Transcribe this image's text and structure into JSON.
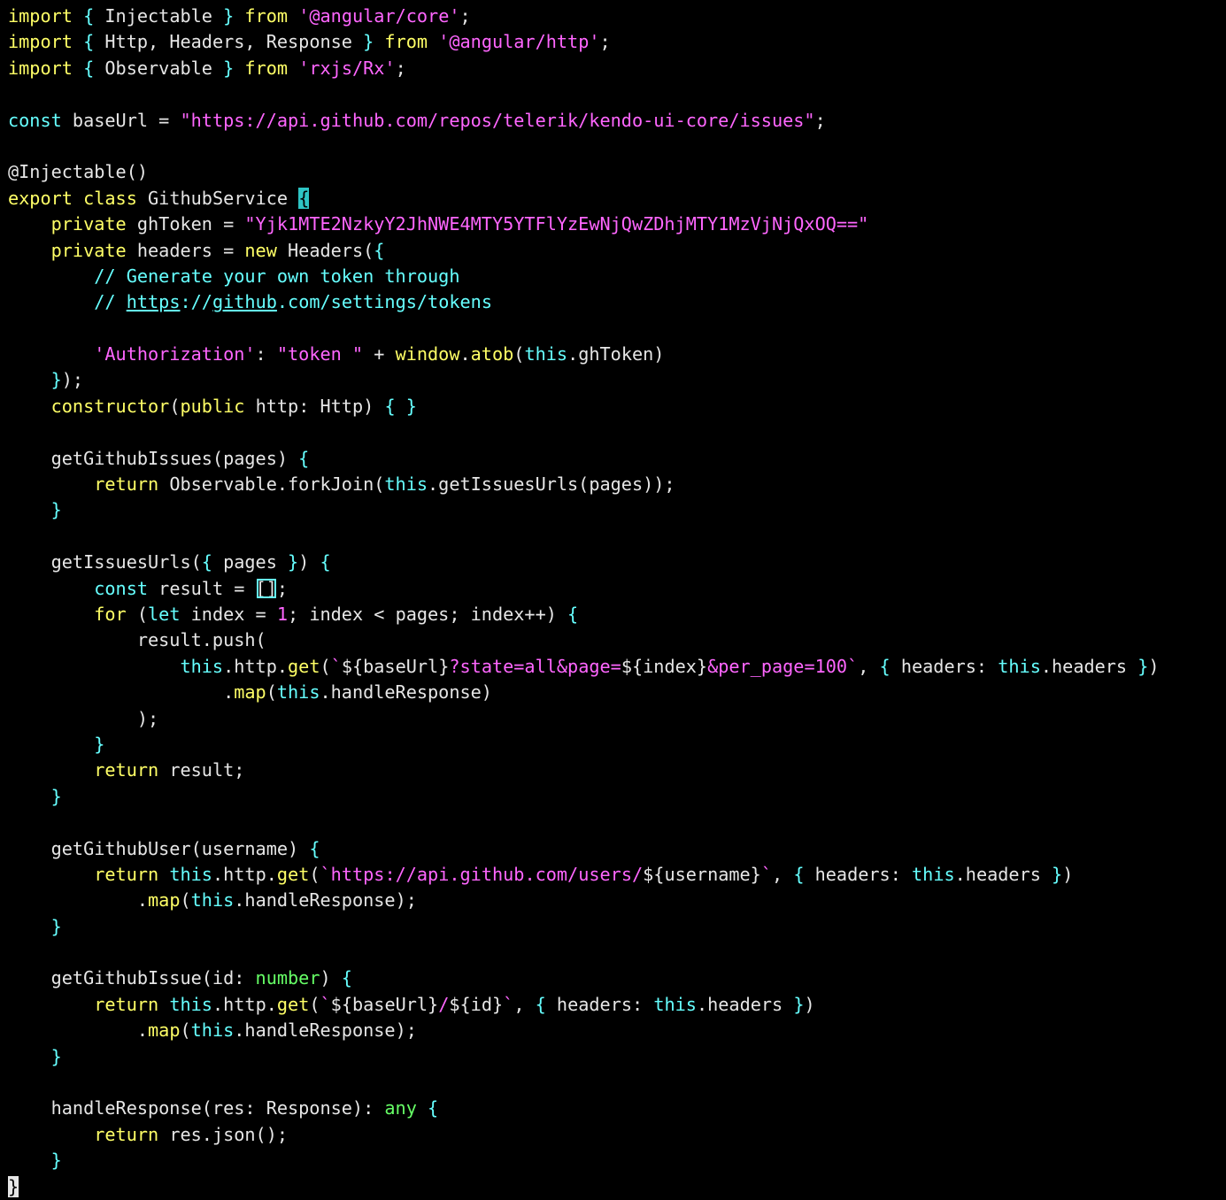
{
  "editor": {
    "colors": {
      "background": "#000000",
      "keyword": "#ffff66",
      "keyword_alt": "#66ffff",
      "string": "#ff66ff",
      "type": "#66ff66",
      "text": "#e6e6e6"
    },
    "lines": [
      [
        [
          "kw",
          "import"
        ],
        [
          "id",
          " "
        ],
        [
          "br",
          "{"
        ],
        [
          "id",
          " Injectable "
        ],
        [
          "br",
          "}"
        ],
        [
          "id",
          " "
        ],
        [
          "kw",
          "from"
        ],
        [
          "id",
          " "
        ],
        [
          "str",
          "'@angular/core'"
        ],
        [
          "id",
          ";"
        ]
      ],
      [
        [
          "kw",
          "import"
        ],
        [
          "id",
          " "
        ],
        [
          "br",
          "{"
        ],
        [
          "id",
          " Http, Headers, Response "
        ],
        [
          "br",
          "}"
        ],
        [
          "id",
          " "
        ],
        [
          "kw",
          "from"
        ],
        [
          "id",
          " "
        ],
        [
          "str",
          "'@angular/http'"
        ],
        [
          "id",
          ";"
        ]
      ],
      [
        [
          "kw",
          "import"
        ],
        [
          "id",
          " "
        ],
        [
          "br",
          "{"
        ],
        [
          "id",
          " Observable "
        ],
        [
          "br",
          "}"
        ],
        [
          "id",
          " "
        ],
        [
          "kw",
          "from"
        ],
        [
          "id",
          " "
        ],
        [
          "str",
          "'rxjs/Rx'"
        ],
        [
          "id",
          ";"
        ]
      ],
      [],
      [
        [
          "kw2",
          "const"
        ],
        [
          "id",
          " baseUrl = "
        ],
        [
          "str",
          "\"https://api.github.com/repos/telerik/kendo-ui-core/issues\""
        ],
        [
          "id",
          ";"
        ]
      ],
      [],
      [
        [
          "id",
          "@Injectable()"
        ]
      ],
      [
        [
          "kw",
          "export"
        ],
        [
          "id",
          " "
        ],
        [
          "kw",
          "class"
        ],
        [
          "id",
          " GithubService "
        ],
        [
          "hl",
          "{"
        ]
      ],
      [
        [
          "id",
          "    "
        ],
        [
          "kw",
          "private"
        ],
        [
          "id",
          " ghToken = "
        ],
        [
          "str",
          "\"Yjk1MTE2NzkyY2JhNWE4MTY5YTFlYzEwNjQwZDhjMTY1MzVjNjQxOQ==\""
        ]
      ],
      [
        [
          "id",
          "    "
        ],
        [
          "kw",
          "private"
        ],
        [
          "id",
          " headers = "
        ],
        [
          "kw",
          "new"
        ],
        [
          "id",
          " Headers("
        ],
        [
          "br",
          "{"
        ]
      ],
      [
        [
          "id",
          "        "
        ],
        [
          "cmt",
          "// Generate your own token through"
        ]
      ],
      [
        [
          "id",
          "        "
        ],
        [
          "cmt",
          "// "
        ],
        [
          "url",
          "https"
        ],
        [
          "cmt",
          "://"
        ],
        [
          "url",
          "github"
        ],
        [
          "cmt",
          ".com/settings/tokens"
        ]
      ],
      [],
      [
        [
          "id",
          "        "
        ],
        [
          "str",
          "'Authorization'"
        ],
        [
          "id",
          ": "
        ],
        [
          "str",
          "\"token \""
        ],
        [
          "id",
          " + "
        ],
        [
          "fn",
          "window"
        ],
        [
          "id",
          "."
        ],
        [
          "fn",
          "atob"
        ],
        [
          "id",
          "("
        ],
        [
          "kw2",
          "this"
        ],
        [
          "id",
          ".ghToken)"
        ]
      ],
      [
        [
          "id",
          "    "
        ],
        [
          "br",
          "}"
        ],
        [
          "id",
          ");"
        ]
      ],
      [
        [
          "id",
          "    "
        ],
        [
          "fn",
          "constructor"
        ],
        [
          "id",
          "("
        ],
        [
          "kw",
          "public"
        ],
        [
          "id",
          " http: Http) "
        ],
        [
          "br",
          "{ }"
        ]
      ],
      [],
      [
        [
          "id",
          "    getGithubIssues(pages) "
        ],
        [
          "br",
          "{"
        ]
      ],
      [
        [
          "id",
          "        "
        ],
        [
          "kw",
          "return"
        ],
        [
          "id",
          " Observable.forkJoin("
        ],
        [
          "kw2",
          "this"
        ],
        [
          "id",
          ".getIssuesUrls(pages));"
        ]
      ],
      [
        [
          "id",
          "    "
        ],
        [
          "br",
          "}"
        ]
      ],
      [],
      [
        [
          "id",
          "    getIssuesUrls("
        ],
        [
          "br",
          "{"
        ],
        [
          "id",
          " pages "
        ],
        [
          "br",
          "}"
        ],
        [
          "id",
          ") "
        ],
        [
          "br",
          "{"
        ]
      ],
      [
        [
          "id",
          "        "
        ],
        [
          "kw2",
          "const"
        ],
        [
          "id",
          " result = "
        ],
        [
          "box",
          "[]"
        ],
        [
          "id",
          ";"
        ]
      ],
      [
        [
          "id",
          "        "
        ],
        [
          "kw",
          "for"
        ],
        [
          "id",
          " ("
        ],
        [
          "kw2",
          "let"
        ],
        [
          "id",
          " index = "
        ],
        [
          "str",
          "1"
        ],
        [
          "id",
          "; index < pages; index++) "
        ],
        [
          "br",
          "{"
        ]
      ],
      [
        [
          "id",
          "            result.push("
        ]
      ],
      [
        [
          "id",
          "                "
        ],
        [
          "kw2",
          "this"
        ],
        [
          "id",
          ".http."
        ],
        [
          "fn",
          "get"
        ],
        [
          "id",
          "("
        ],
        [
          "str",
          "`"
        ],
        [
          "id",
          "${baseUrl}"
        ],
        [
          "str",
          "?state=all&page="
        ],
        [
          "id",
          "${index}"
        ],
        [
          "str",
          "&per_page=100`"
        ],
        [
          "id",
          ", "
        ],
        [
          "br",
          "{"
        ],
        [
          "id",
          " headers: "
        ],
        [
          "kw2",
          "this"
        ],
        [
          "id",
          ".headers "
        ],
        [
          "br",
          "}"
        ],
        [
          "id",
          ")"
        ]
      ],
      [
        [
          "id",
          "                    ."
        ],
        [
          "fn",
          "map"
        ],
        [
          "id",
          "("
        ],
        [
          "kw2",
          "this"
        ],
        [
          "id",
          ".handleResponse)"
        ]
      ],
      [
        [
          "id",
          "            );"
        ]
      ],
      [
        [
          "id",
          "        "
        ],
        [
          "br",
          "}"
        ]
      ],
      [
        [
          "id",
          "        "
        ],
        [
          "kw",
          "return"
        ],
        [
          "id",
          " result;"
        ]
      ],
      [
        [
          "id",
          "    "
        ],
        [
          "br",
          "}"
        ]
      ],
      [],
      [
        [
          "id",
          "    getGithubUser(username) "
        ],
        [
          "br",
          "{"
        ]
      ],
      [
        [
          "id",
          "        "
        ],
        [
          "kw",
          "return"
        ],
        [
          "id",
          " "
        ],
        [
          "kw2",
          "this"
        ],
        [
          "id",
          ".http."
        ],
        [
          "fn",
          "get"
        ],
        [
          "id",
          "("
        ],
        [
          "str",
          "`https://api.github.com/users/"
        ],
        [
          "id",
          "${username}"
        ],
        [
          "str",
          "`"
        ],
        [
          "id",
          ", "
        ],
        [
          "br",
          "{"
        ],
        [
          "id",
          " headers: "
        ],
        [
          "kw2",
          "this"
        ],
        [
          "id",
          ".headers "
        ],
        [
          "br",
          "}"
        ],
        [
          "id",
          ")"
        ]
      ],
      [
        [
          "id",
          "            ."
        ],
        [
          "fn",
          "map"
        ],
        [
          "id",
          "("
        ],
        [
          "kw2",
          "this"
        ],
        [
          "id",
          ".handleResponse);"
        ]
      ],
      [
        [
          "id",
          "    "
        ],
        [
          "br",
          "}"
        ]
      ],
      [],
      [
        [
          "id",
          "    getGithubIssue(id: "
        ],
        [
          "ty",
          "number"
        ],
        [
          "id",
          ") "
        ],
        [
          "br",
          "{"
        ]
      ],
      [
        [
          "id",
          "        "
        ],
        [
          "kw",
          "return"
        ],
        [
          "id",
          " "
        ],
        [
          "kw2",
          "this"
        ],
        [
          "id",
          ".http."
        ],
        [
          "fn",
          "get"
        ],
        [
          "id",
          "("
        ],
        [
          "str",
          "`"
        ],
        [
          "id",
          "${baseUrl}"
        ],
        [
          "str",
          "/"
        ],
        [
          "id",
          "${id}"
        ],
        [
          "str",
          "`"
        ],
        [
          "id",
          ", "
        ],
        [
          "br",
          "{"
        ],
        [
          "id",
          " headers: "
        ],
        [
          "kw2",
          "this"
        ],
        [
          "id",
          ".headers "
        ],
        [
          "br",
          "}"
        ],
        [
          "id",
          ")"
        ]
      ],
      [
        [
          "id",
          "            ."
        ],
        [
          "fn",
          "map"
        ],
        [
          "id",
          "("
        ],
        [
          "kw2",
          "this"
        ],
        [
          "id",
          ".handleResponse);"
        ]
      ],
      [
        [
          "id",
          "    "
        ],
        [
          "br",
          "}"
        ]
      ],
      [],
      [
        [
          "id",
          "    handleResponse(res: Response): "
        ],
        [
          "ty",
          "any"
        ],
        [
          "id",
          " "
        ],
        [
          "br",
          "{"
        ]
      ],
      [
        [
          "id",
          "        "
        ],
        [
          "kw",
          "return"
        ],
        [
          "id",
          " res.json();"
        ]
      ],
      [
        [
          "id",
          "    "
        ],
        [
          "br",
          "}"
        ]
      ],
      [
        [
          "cursor",
          "}"
        ]
      ]
    ]
  }
}
